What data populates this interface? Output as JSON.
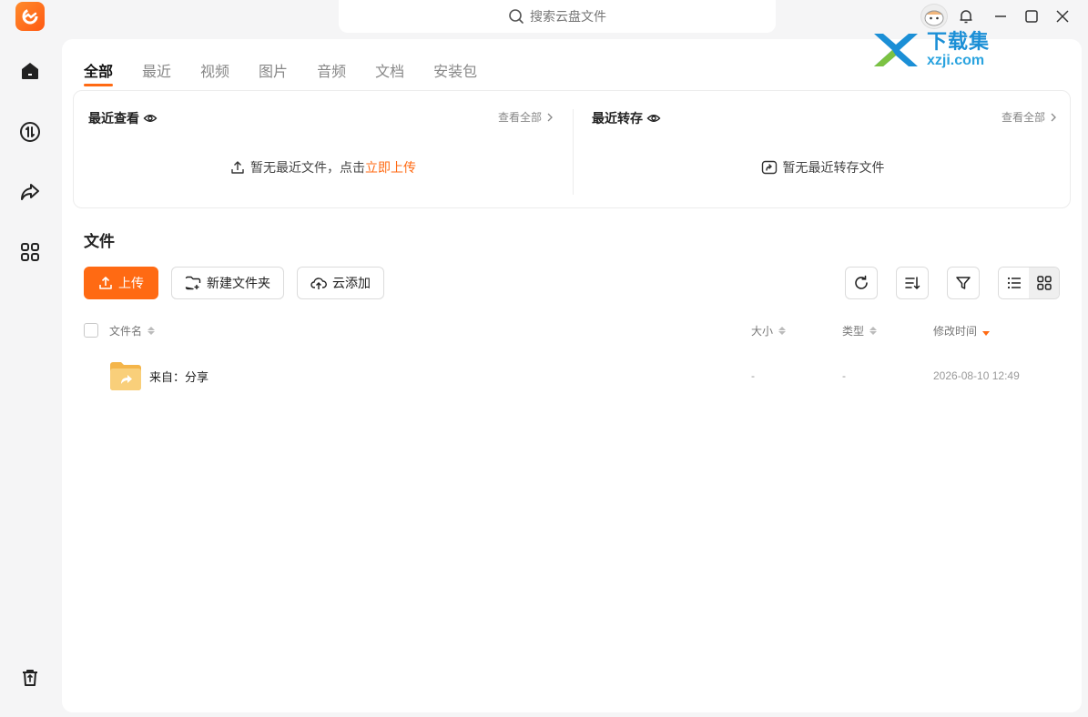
{
  "search": {
    "placeholder": "搜索云盘文件"
  },
  "watermark": {
    "cn": "下载集",
    "en": "xzji.com"
  },
  "tabs": [
    {
      "label": "全部",
      "active": true
    },
    {
      "label": "最近"
    },
    {
      "label": "视频"
    },
    {
      "label": "图片"
    },
    {
      "label": "音频"
    },
    {
      "label": "文档"
    },
    {
      "label": "安装包"
    }
  ],
  "recent_viewed": {
    "title": "最近查看",
    "view_all": "查看全部",
    "empty_prefix": "暂无最近文件，点击",
    "empty_link": "立即上传"
  },
  "recent_saved": {
    "title": "最近转存",
    "view_all": "查看全部",
    "empty": "暂无最近转存文件"
  },
  "files": {
    "title": "文件",
    "upload": "上传",
    "new_folder": "新建文件夹",
    "cloud_add": "云添加",
    "columns": {
      "name": "文件名",
      "size": "大小",
      "type": "类型",
      "modified": "修改时间"
    },
    "rows": [
      {
        "name": "来自：分享",
        "size": "-",
        "type": "-",
        "modified": "2026-08-10 12:49"
      }
    ]
  },
  "colors": {
    "accent": "#ff6a13",
    "folder": "#f7c56a"
  }
}
